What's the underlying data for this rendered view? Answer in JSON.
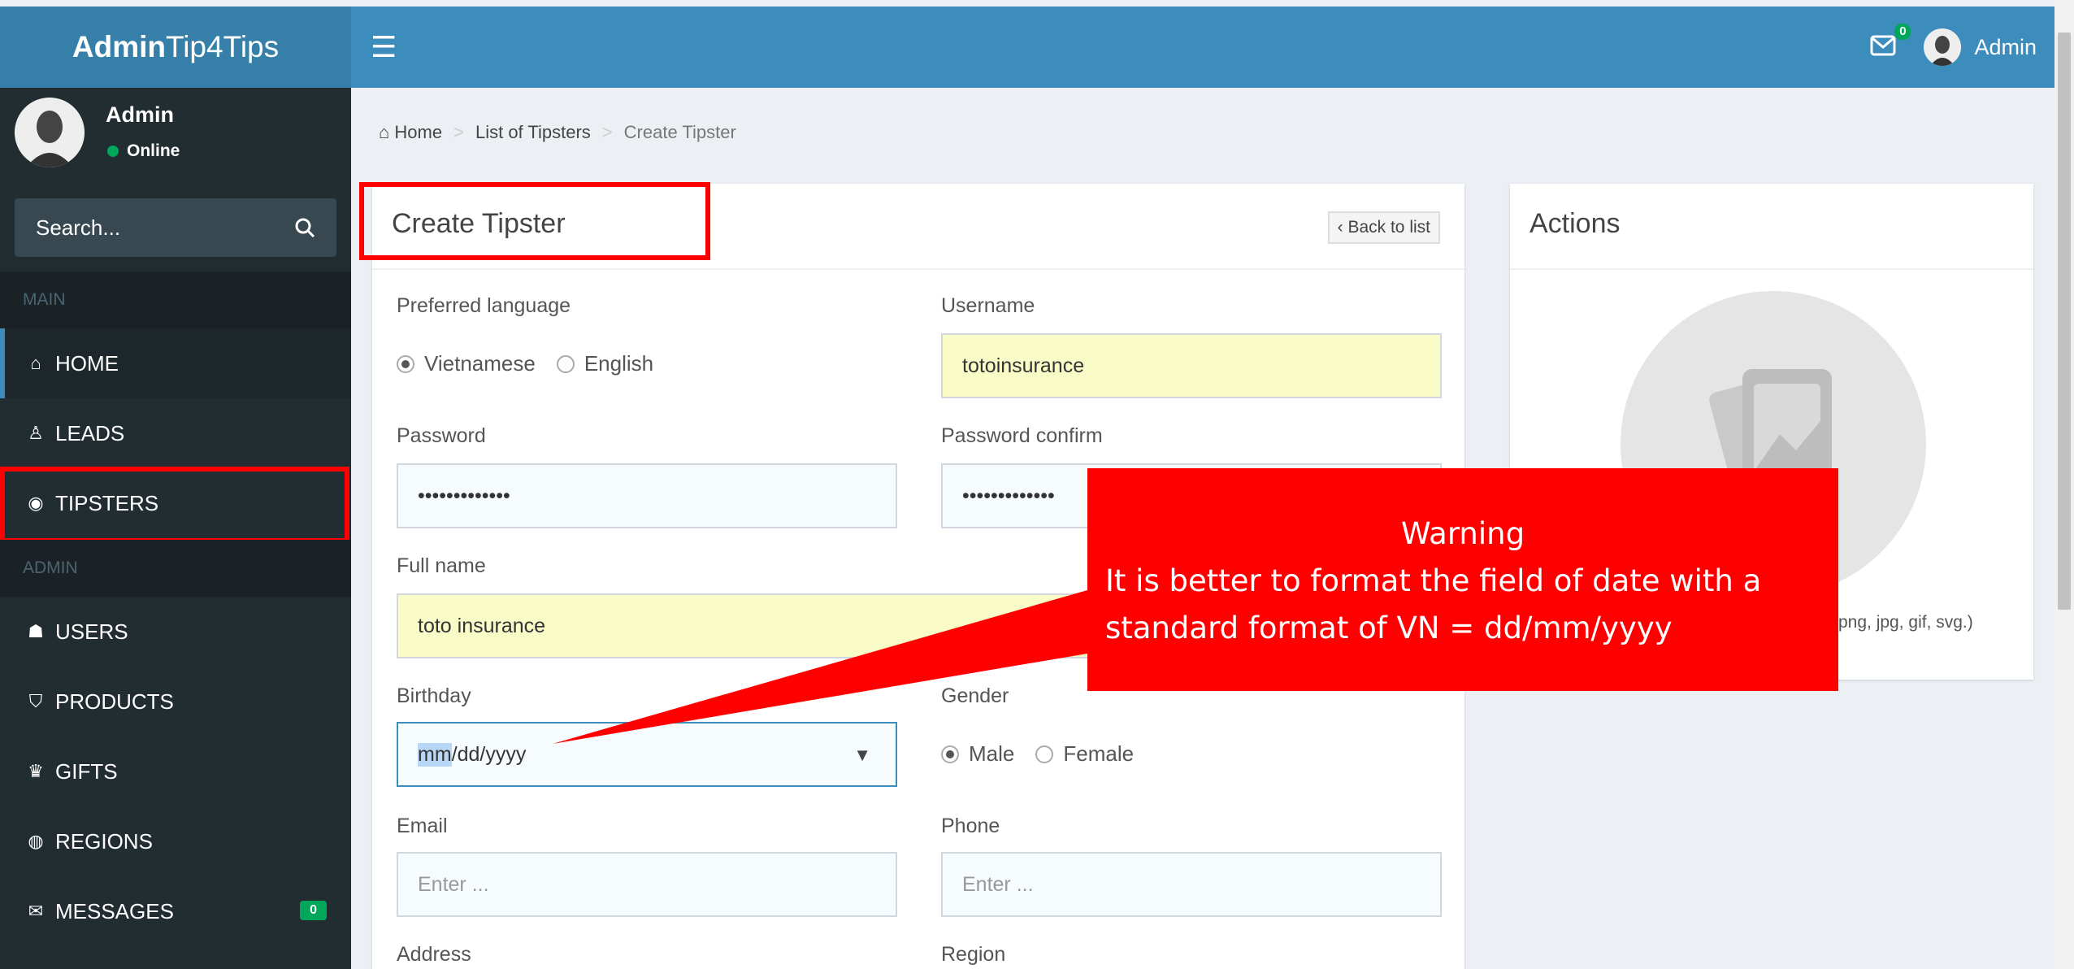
{
  "app": {
    "logo_bold": "Admin",
    "logo_rest": "Tip4Tips",
    "mail_count": "0",
    "top_user": "Admin"
  },
  "user_panel": {
    "name": "Admin",
    "status": "Online"
  },
  "search": {
    "placeholder": "Search..."
  },
  "nav": {
    "main_header": "MAIN",
    "admin_header": "ADMIN",
    "items": [
      {
        "label": "HOME",
        "icon": "home-icon"
      },
      {
        "label": "LEADS",
        "icon": "user-icon"
      },
      {
        "label": "TIPSTERS",
        "icon": "eye-icon"
      },
      {
        "label": "USERS",
        "icon": "users-icon"
      },
      {
        "label": "PRODUCTS",
        "icon": "shield-icon"
      },
      {
        "label": "GIFTS",
        "icon": "gift-icon"
      },
      {
        "label": "REGIONS",
        "icon": "globe-icon"
      },
      {
        "label": "MESSAGES",
        "icon": "envelope-icon",
        "badge": "0"
      }
    ]
  },
  "breadcrumb": {
    "home": "Home",
    "list": "List of Tipsters",
    "current": "Create Tipster"
  },
  "form": {
    "title": "Create Tipster",
    "back_label": "‹ Back to list",
    "preferred_language_label": "Preferred language",
    "lang_options": [
      "Vietnamese",
      "English"
    ],
    "username_label": "Username",
    "username_value": "totoinsurance",
    "password_label": "Password",
    "password_value": "•••••••••••••",
    "password_confirm_label": "Password confirm",
    "password_confirm_value": "•••••••••••••",
    "fullname_label": "Full name",
    "fullname_value": "toto insurance",
    "birthday_label": "Birthday",
    "birthday_mm": "mm",
    "birthday_rest": "/dd/yyyy",
    "gender_label": "Gender",
    "gender_options": [
      "Male",
      "Female"
    ],
    "email_label": "Email",
    "email_placeholder": "Enter ...",
    "phone_label": "Phone",
    "phone_placeholder": "Enter ...",
    "address_label": "Address",
    "region_label": "Region"
  },
  "actions": {
    "title": "Actions",
    "upload_hint": "png, jpg, gif, svg.)"
  },
  "warning": {
    "title": "Warning",
    "line1": "It is better to format the field of date with a",
    "line2": "standard format of VN = dd/mm/yyyy"
  },
  "colors": {
    "header": "#3c8dbc",
    "sidebar": "#222d32",
    "highlight": "#ff0000",
    "badge": "#00a65a"
  }
}
